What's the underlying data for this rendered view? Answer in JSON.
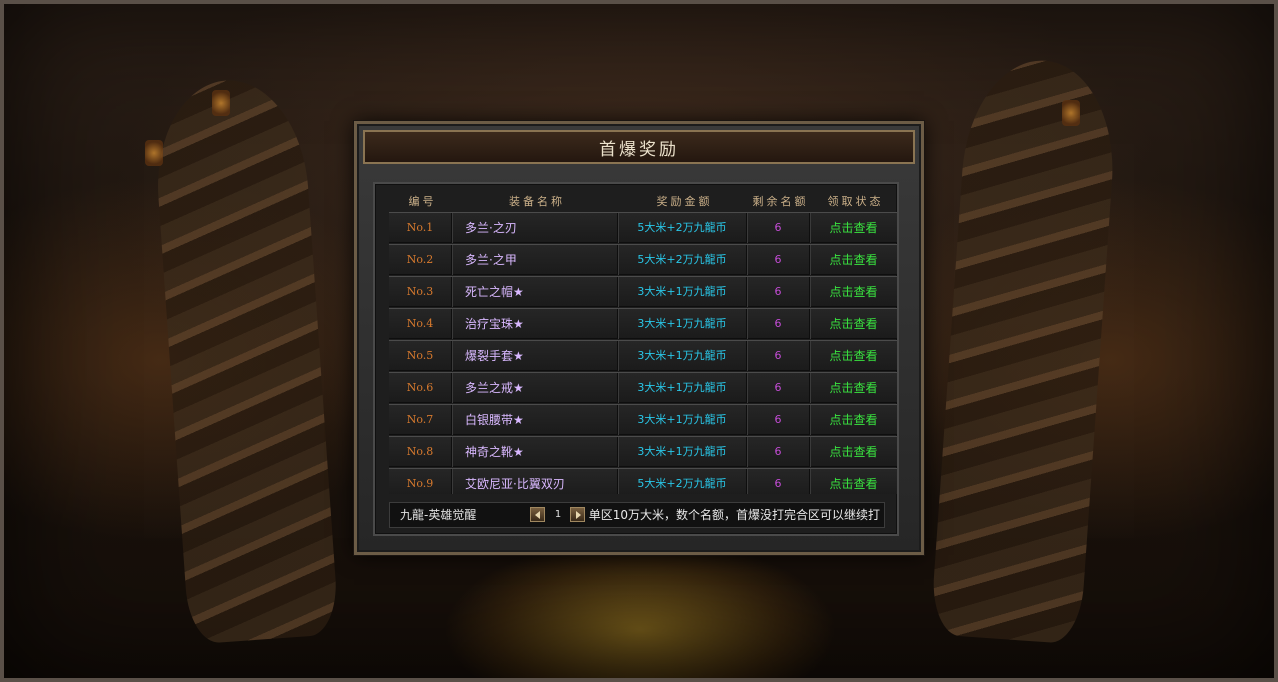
{
  "panel": {
    "title": "首爆奖励",
    "headers": [
      "编号",
      "装备名称",
      "奖励金额",
      "剩余名额",
      "领取状态"
    ]
  },
  "rows": [
    {
      "no": "No.1",
      "name": "多兰·之刃",
      "reward": "5大米+2万九龍币",
      "remaining": "6",
      "status": "点击查看"
    },
    {
      "no": "No.2",
      "name": "多兰·之甲",
      "reward": "5大米+2万九龍币",
      "remaining": "6",
      "status": "点击查看"
    },
    {
      "no": "No.3",
      "name": "死亡之帽★",
      "reward": "3大米+1万九龍币",
      "remaining": "6",
      "status": "点击查看"
    },
    {
      "no": "No.4",
      "name": "治疗宝珠★",
      "reward": "3大米+1万九龍币",
      "remaining": "6",
      "status": "点击查看"
    },
    {
      "no": "No.5",
      "name": "爆裂手套★",
      "reward": "3大米+1万九龍币",
      "remaining": "6",
      "status": "点击查看"
    },
    {
      "no": "No.6",
      "name": "多兰之戒★",
      "reward": "3大米+1万九龍币",
      "remaining": "6",
      "status": "点击查看"
    },
    {
      "no": "No.7",
      "name": "白银腰带★",
      "reward": "3大米+1万九龍币",
      "remaining": "6",
      "status": "点击查看"
    },
    {
      "no": "No.8",
      "name": "神奇之靴★",
      "reward": "3大米+1万九龍币",
      "remaining": "6",
      "status": "点击查看"
    },
    {
      "no": "No.9",
      "name": "艾欧尼亚·比翼双刃",
      "reward": "5大米+2万九龍币",
      "remaining": "6",
      "status": "点击查看"
    }
  ],
  "footer": {
    "server": "九龍-英雄觉醒",
    "page": "1",
    "note": "单区10万大米，数个名额，首爆没打完合区可以继续打"
  },
  "colors": {
    "number": "#d87a2e",
    "item_name": "#d9b8ff",
    "reward": "#29c7e8",
    "remaining": "#c44cd6",
    "status": "#39e23f",
    "header": "#cbb089"
  },
  "icons": [
    "prev-page-icon",
    "next-page-icon"
  ]
}
